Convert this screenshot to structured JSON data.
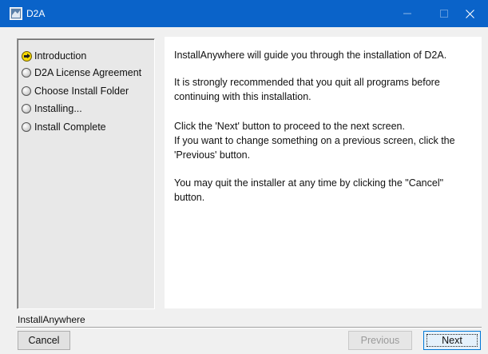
{
  "window": {
    "title": "D2A",
    "title_bar_color": "#0a63c9"
  },
  "icons": {
    "app": "installer-app-icon",
    "minimize": "minimize-icon",
    "maximize": "maximize-icon",
    "close": "close-icon",
    "current_step": "arrow-right-icon",
    "pending_step": "radio-bullet-icon"
  },
  "steps": [
    {
      "label": "Introduction",
      "state": "current"
    },
    {
      "label": "D2A License Agreement",
      "state": "pending"
    },
    {
      "label": "Choose Install Folder",
      "state": "pending"
    },
    {
      "label": "Installing...",
      "state": "pending"
    },
    {
      "label": "Install Complete",
      "state": "pending"
    }
  ],
  "content": {
    "p1": "InstallAnywhere will guide you through the installation of D2A.",
    "p2": "It is strongly recommended that you quit all programs before continuing with this installation.",
    "p3_line1": "Click the 'Next' button to proceed to the next screen.",
    "p3_line2": "If you want to change something on a previous screen, click the 'Previous' button.",
    "p4": "You may quit the installer at any time by clicking the \"Cancel\" button."
  },
  "footer": {
    "brand": "InstallAnywhere",
    "cancel_label": "Cancel",
    "previous_label": "Previous",
    "next_label": "Next"
  }
}
